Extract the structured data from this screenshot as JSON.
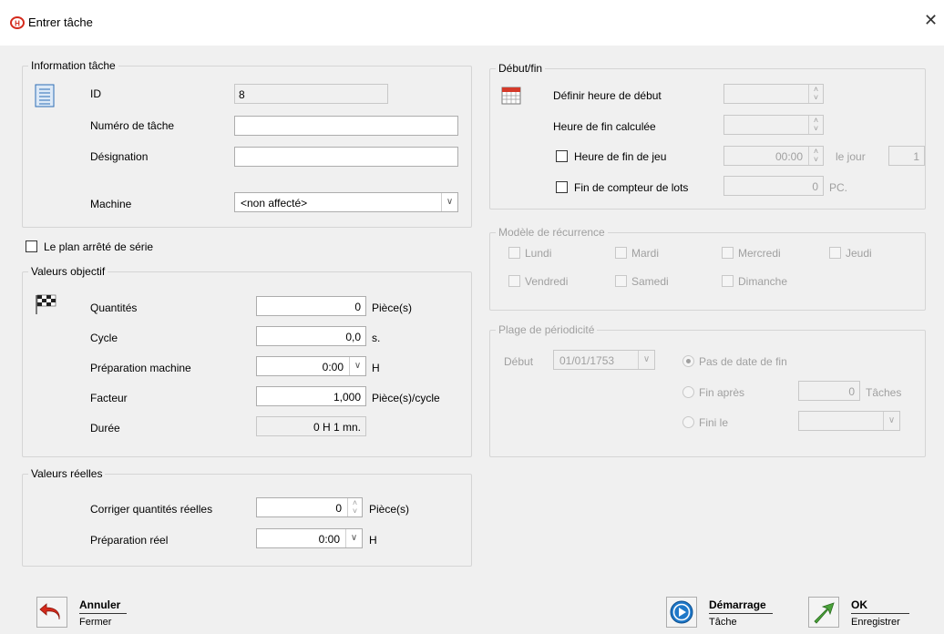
{
  "window": {
    "title": "Entrer tâche",
    "close_glyph": "✕"
  },
  "info": {
    "legend": "Information tâche",
    "id_label": "ID",
    "id_value": "8",
    "numero_label": "Numéro de tâche",
    "numero_value": "",
    "designation_label": "Désignation",
    "designation_value": "",
    "machine_label": "Machine",
    "machine_value": "<non affecté>"
  },
  "serie_checkbox_label": "Le plan arrêté de série",
  "objectif": {
    "legend": "Valeurs objectif",
    "quantites_label": "Quantités",
    "quantites_value": "0",
    "quantites_unit": "Pièce(s)",
    "cycle_label": "Cycle",
    "cycle_value": "0,0",
    "cycle_unit": "s.",
    "preparation_label": "Préparation machine",
    "preparation_value": "0:00",
    "preparation_unit": "H",
    "facteur_label": "Facteur",
    "facteur_value": "1,000",
    "facteur_unit": "Pièce(s)/cycle",
    "duree_label": "Durée",
    "duree_value": "0 H 1 mn."
  },
  "reelles": {
    "legend": "Valeurs réelles",
    "corriger_label": "Corriger quantités réelles",
    "corriger_value": "0",
    "corriger_unit": "Pièce(s)",
    "prep_reel_label": "Préparation réel",
    "prep_reel_value": "0:00",
    "prep_reel_unit": "H"
  },
  "debut_fin": {
    "legend": "Début/fin",
    "definir_label": "Définir heure de début",
    "definir_value": "",
    "fin_calculee_label": "Heure de fin calculée",
    "fin_calculee_value": "",
    "fin_jeu_label": "Heure de fin de jeu",
    "fin_jeu_value": "00:00",
    "le_jour_label": "le jour",
    "le_jour_value": "1",
    "fin_compteur_label": "Fin de compteur de lots",
    "fin_compteur_value": "0",
    "fin_compteur_unit": "PC."
  },
  "recurrence": {
    "legend": "Modèle de récurrence",
    "days": [
      "Lundi",
      "Mardi",
      "Mercredi",
      "Jeudi",
      "Vendredi",
      "Samedi",
      "Dimanche"
    ]
  },
  "periodicite": {
    "legend": "Plage de périodicité",
    "debut_label": "Début",
    "debut_value": "01/01/1753",
    "pas_de_fin_label": "Pas de date de fin",
    "fin_apres_label": "Fin après",
    "fin_apres_value": "0",
    "fin_apres_unit": "Tâches",
    "fini_le_label": "Fini le",
    "fini_le_value": ""
  },
  "buttons": {
    "annuler_title": "Annuler",
    "annuler_sub": "Fermer",
    "demarrage_title": "Démarrage",
    "demarrage_sub": "Tâche",
    "ok_title": "OK",
    "ok_sub": "Enregistrer"
  },
  "colors": {
    "accent_red": "#d42a1c",
    "play_blue": "#1f78c8",
    "ok_green": "#4aa33a"
  },
  "icons": [
    "app-logo-icon",
    "close-icon",
    "id-card-icon",
    "checkered-flag-icon",
    "calendar-icon",
    "undo-arrow-icon",
    "play-icon",
    "ok-arrow-icon"
  ]
}
